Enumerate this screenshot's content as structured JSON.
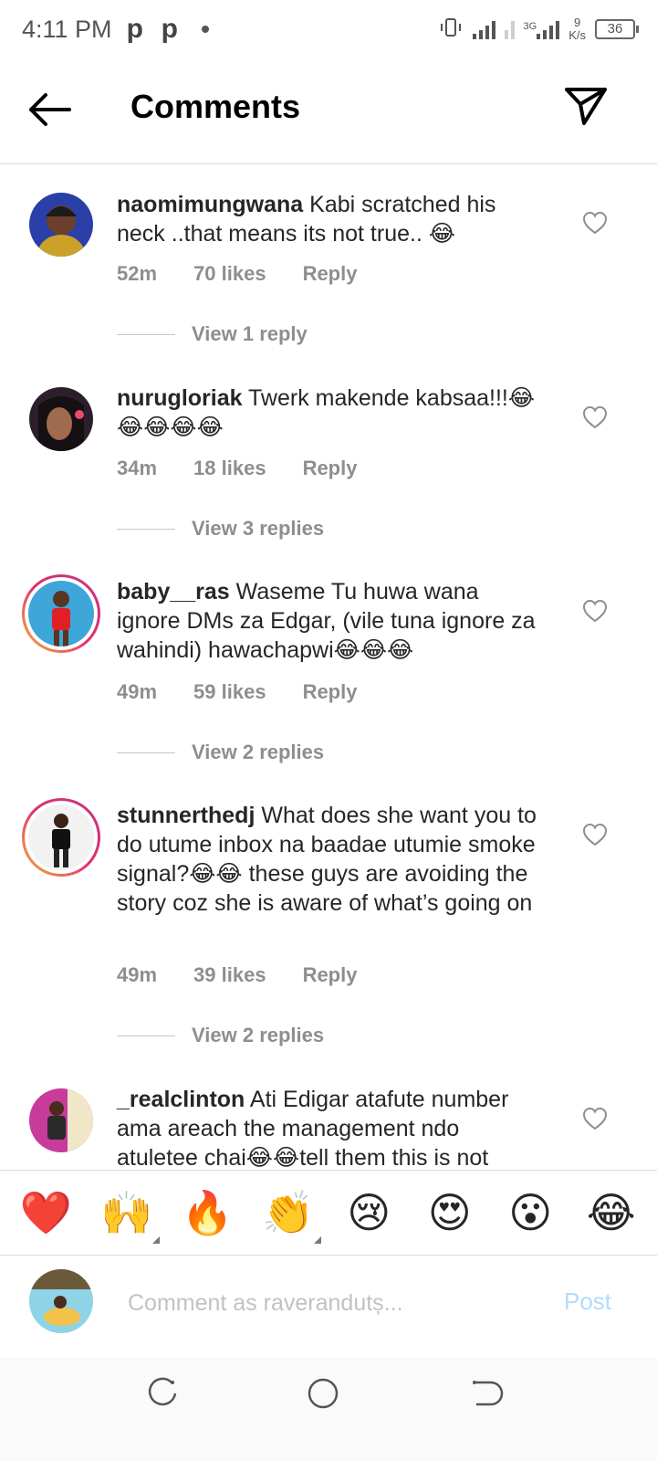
{
  "status_bar": {
    "time": "4:11 PM",
    "notification_icons": [
      "p",
      "p"
    ],
    "network_type": "3G",
    "net_speed_value": "9",
    "net_speed_unit": "K/s",
    "battery": "36"
  },
  "header": {
    "title": "Comments",
    "back_icon": "arrow-left-icon",
    "share_icon": "paper-plane-icon"
  },
  "comments": [
    {
      "username": "naomimungwana",
      "text": "Kabi scratched his neck ..that means its not true.. 😂",
      "time": "52m",
      "likes": "70 likes",
      "reply": "Reply",
      "view_replies": "View 1 reply"
    },
    {
      "username": "nurugloriak",
      "text": "Twerk makende kabsaa!!!😂😂😂😂😂",
      "time": "34m",
      "likes": "18 likes",
      "reply": "Reply",
      "view_replies": "View 3 replies"
    },
    {
      "username": "baby__ras",
      "text": "Waseme Tu huwa wana ignore DMs za Edgar, (vile tuna ignore za wahindi) hawachapwi😂😂😂",
      "time": "49m",
      "likes": "59 likes",
      "reply": "Reply",
      "view_replies": "View 2 replies"
    },
    {
      "username": "stunnerthedj",
      "text": "What does she want you to do utume inbox na baadae utumie smoke signal?😂😂 these guys are avoiding the story coz she is aware of what’s going on",
      "time": "49m",
      "likes": "39 likes",
      "reply": "Reply",
      "view_replies": "View 2 replies"
    },
    {
      "username": "_realclinton",
      "text": "Ati Edigar atafute number ama areach the management ndo atuletee chai😂😂tell them this is not"
    }
  ],
  "emoji_bar": [
    "❤️",
    "🙌",
    "🔥",
    "👏",
    "😢",
    "😍",
    "😮",
    "😂"
  ],
  "composer": {
    "placeholder": "Comment as raverandutș...",
    "post_label": "Post"
  },
  "colors": {
    "accent_post": "#b3dbff",
    "muted_text": "#8e8e8e",
    "story_ring_start": "#f7b23b",
    "story_ring_end": "#c13584"
  }
}
